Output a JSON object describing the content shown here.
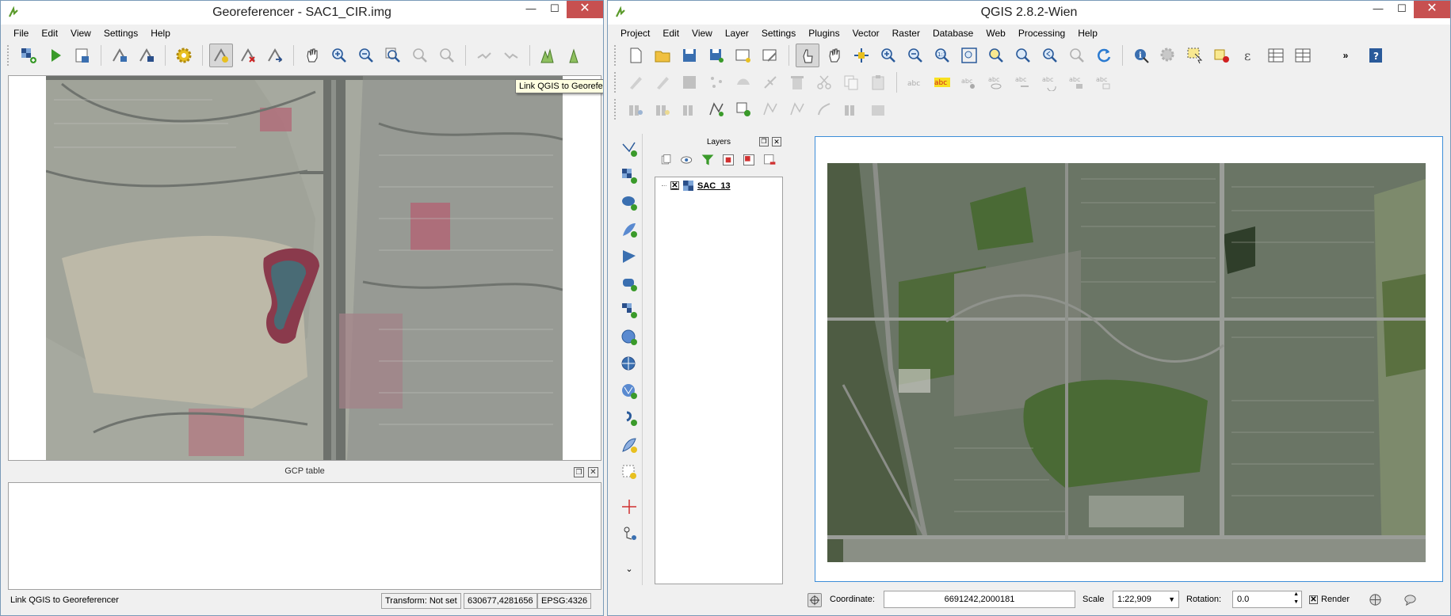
{
  "georeferencer": {
    "title": "Georeferencer - SAC1_CIR.img",
    "menu": [
      "File",
      "Edit",
      "View",
      "Settings",
      "Help"
    ],
    "gcp_table_title": "GCP table",
    "status_message": "Link QGIS to Georeferencer",
    "transform": "Transform: Not set",
    "coordinate": "630677,4281656",
    "epsg": "EPSG:4326"
  },
  "tooltip": "Link QGIS to Georeferencer",
  "qgis": {
    "title": "QGIS 2.8.2-Wien",
    "menu": [
      "Project",
      "Edit",
      "View",
      "Layer",
      "Settings",
      "Plugins",
      "Vector",
      "Raster",
      "Database",
      "Web",
      "Processing",
      "Help"
    ],
    "layers_panel_title": "Layers",
    "layer_name": "SAC_13",
    "coordinate_label": "Coordinate:",
    "coordinate_value": "6691242,2000181",
    "scale_label": "Scale",
    "scale_value": "1:22,909",
    "rotation_label": "Rotation:",
    "rotation_value": "0.0",
    "render_label": "Render"
  },
  "window_controls": {
    "minimize": "—",
    "maximize": "☐",
    "close": "✕"
  }
}
